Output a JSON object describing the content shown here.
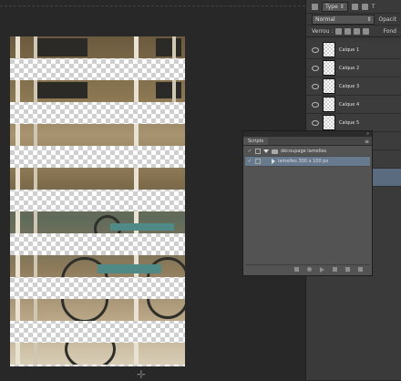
{
  "options_bar": {
    "type_select": "Type",
    "blend_mode": "Normal",
    "opacity_label": "Opacit",
    "lock_label": "Verrou :",
    "fill_label": "Fond"
  },
  "layers": [
    {
      "label": "Calque 1"
    },
    {
      "label": "Calque 2"
    },
    {
      "label": "Calque 3"
    },
    {
      "label": "Calque 4"
    },
    {
      "label": "Calque 5"
    }
  ],
  "scripts_panel": {
    "tab_label": "Scripts",
    "collapse_glyph": "»",
    "menu_glyph": "≡",
    "items": [
      {
        "check": "✓",
        "label": "découpage lamelles",
        "kind": "set"
      },
      {
        "check": "✓",
        "label": "lamelles 300 x 100 px",
        "kind": "action"
      }
    ]
  },
  "icons": [
    "eye-icon",
    "folder-icon",
    "play-icon",
    "stop-icon",
    "record-icon",
    "new-icon",
    "trash-icon"
  ]
}
